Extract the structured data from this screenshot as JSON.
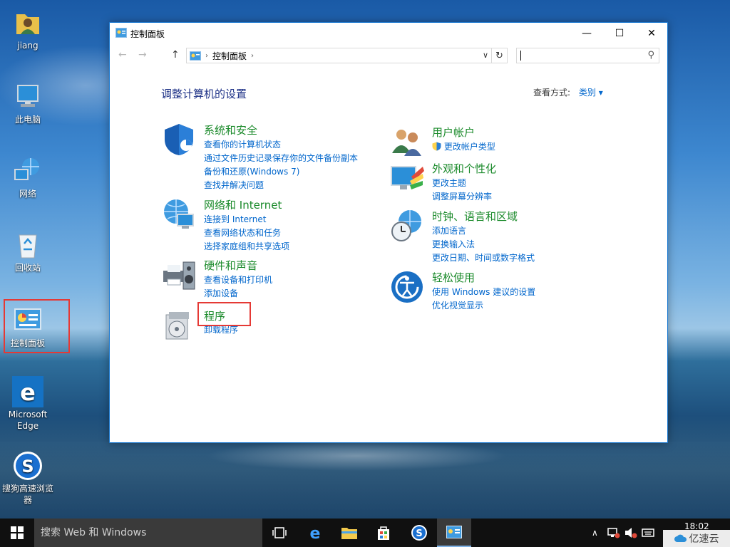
{
  "desktop": {
    "icons": [
      {
        "label": "jiang"
      },
      {
        "label": "此电脑"
      },
      {
        "label": "网络"
      },
      {
        "label": "回收站"
      },
      {
        "label": "控制面板"
      },
      {
        "label": "Microsoft Edge"
      },
      {
        "label": "搜狗高速浏览器"
      }
    ],
    "highlight_color": "#e53935"
  },
  "window": {
    "title": "控制面板",
    "controls": {
      "minimize": "—",
      "maximize": "☐",
      "close": "✕"
    },
    "address": {
      "crumb": "控制面板"
    },
    "search": {
      "value": ""
    },
    "heading": "调整计算机的设置",
    "view_by": {
      "label": "查看方式:",
      "value": "类别 ▾"
    },
    "categories_left": [
      {
        "icon": "shield-icon",
        "title": "系统和安全",
        "links": [
          "查看你的计算机状态",
          "通过文件历史记录保存你的文件备份副本",
          "备份和还原(Windows 7)",
          "查找并解决问题"
        ]
      },
      {
        "icon": "network-globe-icon",
        "title": "网络和 Internet",
        "links": [
          "连接到 Internet",
          "查看网络状态和任务",
          "选择家庭组和共享选项"
        ]
      },
      {
        "icon": "printer-speaker-icon",
        "title": "硬件和声音",
        "links": [
          "查看设备和打印机",
          "添加设备"
        ]
      },
      {
        "icon": "programs-disc-icon",
        "title": "程序",
        "links": [
          "卸载程序"
        ]
      }
    ],
    "categories_right": [
      {
        "icon": "users-icon",
        "title": "用户帐户",
        "links": [
          "更改帐户类型"
        ]
      },
      {
        "icon": "appearance-icon",
        "title": "外观和个性化",
        "links": [
          "更改主题",
          "调整屏幕分辨率"
        ]
      },
      {
        "icon": "clock-globe-icon",
        "title": "时钟、语言和区域",
        "links": [
          "添加语言",
          "更换输入法",
          "更改日期、时间或数字格式"
        ]
      },
      {
        "icon": "ease-of-access-icon",
        "title": "轻松使用",
        "links": [
          "使用 Windows 建议的设置",
          "优化视觉显示"
        ]
      }
    ]
  },
  "taskbar": {
    "search_placeholder": "搜索 Web 和 Windows",
    "clock_time": "18:02",
    "watermark": "亿速云"
  },
  "colors": {
    "category_title": "#1a8a2a",
    "link": "#0066cc",
    "heading": "#1e3287"
  }
}
